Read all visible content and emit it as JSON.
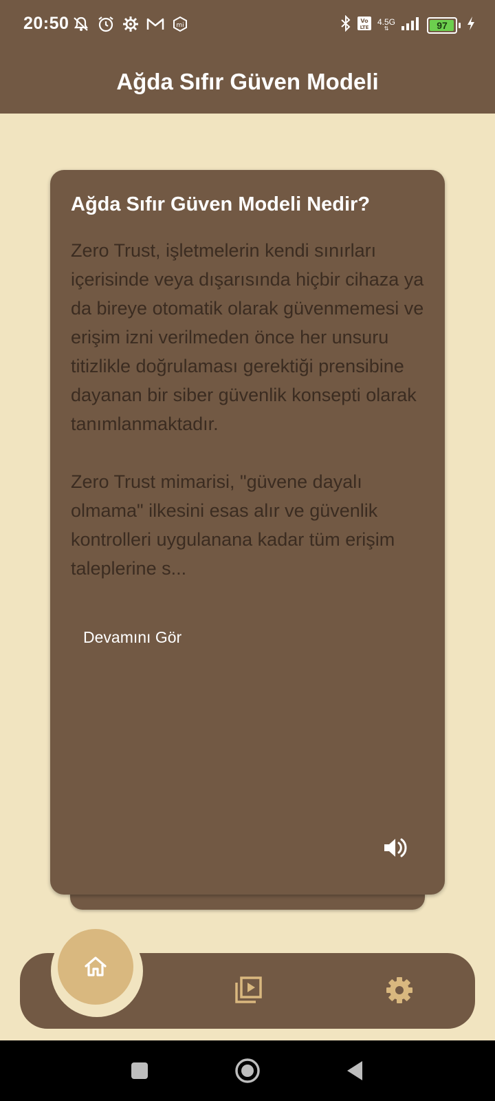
{
  "status_bar": {
    "time": "20:50",
    "network": "4.5G",
    "battery": "97",
    "battery_level": 0.97,
    "left_icons": [
      "mute-icon",
      "alarm-icon",
      "settings-gear-icon",
      "gmail-icon",
      "mi-icon"
    ],
    "right_icons": [
      "bluetooth-icon",
      "volte-icon",
      "signal-icon",
      "battery-icon",
      "charging-icon"
    ]
  },
  "app_bar": {
    "title": "Ağda Sıfır Güven Modeli"
  },
  "card": {
    "title": "Ağda Sıfır Güven Modeli Nedir?",
    "body": "Zero Trust, işletmelerin kendi sınırları içerisinde veya dışarısında hiçbir cihaza ya da bireye otomatik olarak güvenmemesi ve erişim izni verilmeden önce her unsuru titizlikle doğrulaması gerektiği prensibine dayanan bir siber güvenlik konsepti olarak tanımlanmaktadır.\n\nZero Trust mimarisi, \"güvene dayalı olmama\" ilkesini esas alır ve güvenlik kontrolleri uygulanana kadar tüm erişim taleplerine s...",
    "more_label": "Devamını Gör"
  },
  "bottom_nav": {
    "items": [
      {
        "icon": "home-icon",
        "active": true
      },
      {
        "icon": "video-library-icon",
        "active": false
      },
      {
        "icon": "settings-icon",
        "active": false
      }
    ]
  },
  "colors": {
    "primary": "#725944",
    "background": "#f1e4c0",
    "accent": "#d9b87f",
    "body_text": "#3b2c21"
  }
}
